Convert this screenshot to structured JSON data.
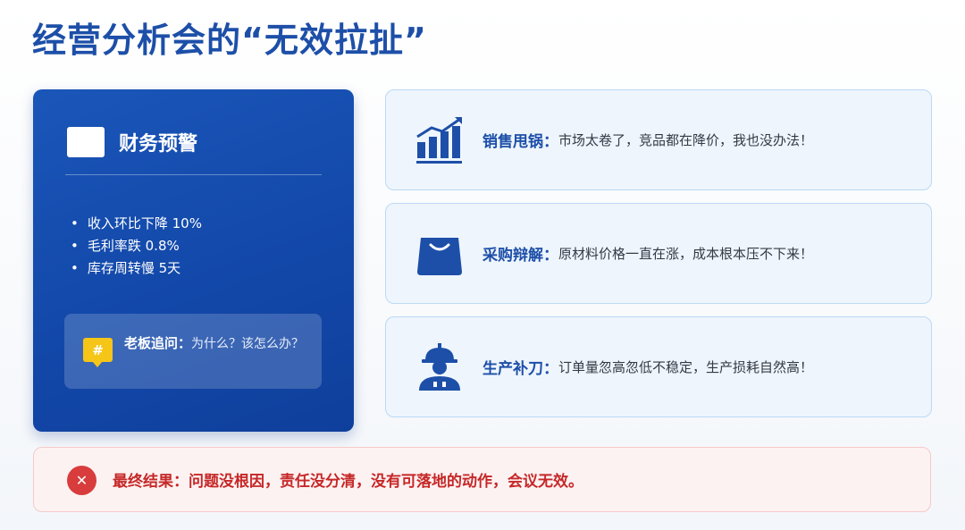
{
  "title": "经营分析会的“无效拉扯”",
  "finance": {
    "title": "财务预警",
    "metrics": [
      "收入环比下降 10%",
      "毛利率跌 0.8%",
      "库存周转慢 5天"
    ],
    "boss_label": "老板追问：",
    "boss_question": "为什么？该怎么办？",
    "boss_icon_glyph": "#"
  },
  "cards": [
    {
      "icon": "rising-chart-icon",
      "label": "销售甩锅：",
      "text": "市场太卷了，竞品都在降价，我也没办法！"
    },
    {
      "icon": "shopping-bag-icon",
      "label": "采购辩解：",
      "text": "原材料价格一直在涨，成本根本压不下来！"
    },
    {
      "icon": "hard-hat-worker-icon",
      "label": "生产补刀：",
      "text": "订单量忽高忽低不稳定，生产损耗自然高！"
    }
  ],
  "result": {
    "icon_glyph": "✕",
    "text": "最终结果：问题没根因，责任没分清，没有可落地的动作，会议无效。"
  },
  "colors": {
    "primary": "#1d4fa8",
    "danger": "#d93c3c",
    "warning": "#f5c518"
  }
}
